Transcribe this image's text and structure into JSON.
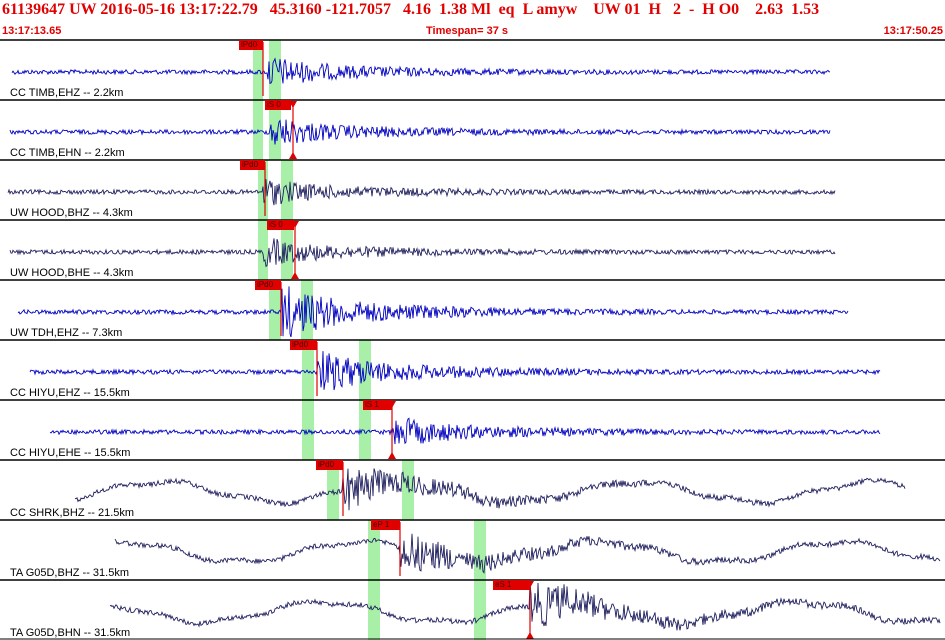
{
  "header": {
    "event_line": "61139647 UW 2016-05-16 13:17:22.79   45.3160 -121.7057   4.16  1.38 Ml  eq  L amyw    UW 01  H   2  -  H O0    2.63  1.53"
  },
  "timebar": {
    "start": "13:17:13.65",
    "span": "Timespan=  37 s",
    "end": "13:17:50.25"
  },
  "colors": {
    "header_text": "#e00000",
    "trace_primary": "#0000c0",
    "trace_secondary": "#202060",
    "window": "#a8f0a8",
    "pick": "#e00000",
    "separator": "#000000"
  },
  "traces": [
    {
      "label": "CC TIMB,EHZ -- 2.2km",
      "pick": "iPd0"
    },
    {
      "label": "CC TIMB,EHN -- 2.2km",
      "pick": "iS 0"
    },
    {
      "label": "UW HOOD,BHZ -- 4.3km",
      "pick": "iPd0"
    },
    {
      "label": "UW HOOD,BHE -- 4.3km",
      "pick": "iS 0"
    },
    {
      "label": "UW TDH,EHZ -- 7.3km",
      "pick": "iPd0"
    },
    {
      "label": "CC HIYU,EHZ -- 15.5km",
      "pick": "iPd0"
    },
    {
      "label": "CC HIYU,EHE -- 15.5km",
      "pick": "iS 1"
    },
    {
      "label": "CC SHRK,BHZ -- 21.5km",
      "pick": "iPd0"
    },
    {
      "label": "TA G05D,BHZ -- 31.5km",
      "pick": "eP 1"
    },
    {
      "label": "TA G05D,BHN -- 31.5km",
      "pick": "eS 1"
    }
  ]
}
